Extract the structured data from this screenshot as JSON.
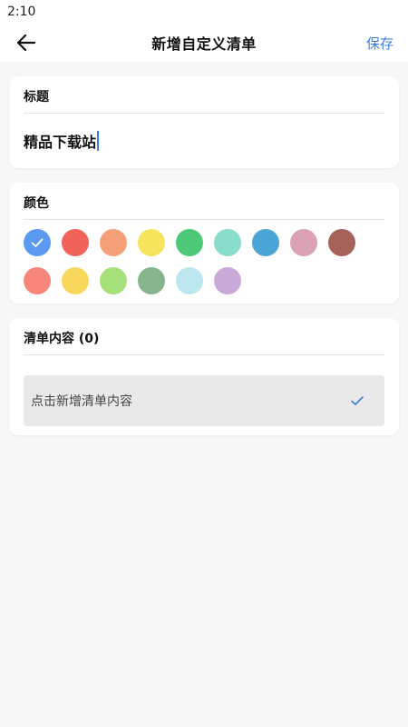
{
  "status_bar": {
    "time": "2:10"
  },
  "app_bar": {
    "title": "新增自定义清单",
    "save_label": "保存",
    "back_icon": "arrow-left-icon"
  },
  "title_section": {
    "heading": "标题",
    "value": "精品下载站"
  },
  "color_section": {
    "heading": "颜色",
    "selected_index": 0,
    "colors": [
      "#5c99f0",
      "#f0625a",
      "#f6a07a",
      "#f6e45c",
      "#4cc876",
      "#8adccb",
      "#4aa5d4",
      "#dba1b6",
      "#a56258",
      "#f6877a",
      "#f9d75d",
      "#a6e07a",
      "#86b48c",
      "#bde6ef",
      "#c8a9d8"
    ]
  },
  "list_section": {
    "heading": "清单内容 (0)",
    "add_item_label": "点击新增清单内容",
    "check_icon": "check-icon"
  },
  "colors": {
    "accent": "#3b7ddd",
    "background": "#f7f7f7",
    "card": "#ffffff"
  }
}
